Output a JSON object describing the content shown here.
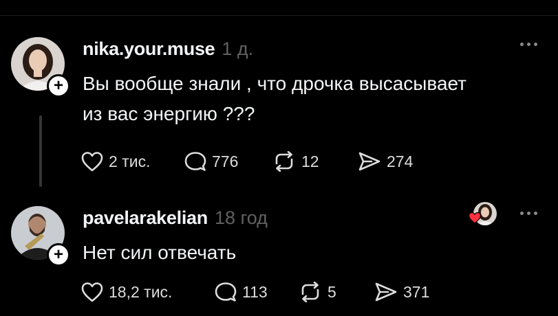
{
  "posts": [
    {
      "username": "nika.your.muse",
      "time": "1 д.",
      "text_lines": [
        "Вы вообще знали , что дрочка высасывает",
        "из вас энергию ???"
      ],
      "likes": "2 тис.",
      "comments": "776",
      "reposts": "12",
      "shares": "274"
    },
    {
      "username": "pavelarakelian",
      "time": "18 год",
      "text_lines": [
        "Нет сил отвечать"
      ],
      "likes": "18,2 тис.",
      "comments": "113",
      "reposts": "5",
      "shares": "371"
    }
  ],
  "icons": {
    "follow": "plus-icon",
    "more": "more-dots-icon",
    "like": "heart-icon",
    "comment": "comment-bubble-icon",
    "repost": "repost-icon",
    "share": "send-icon",
    "liked_by_author": "liked-by-author-icon"
  },
  "colors": {
    "background": "#000000",
    "text": "#f3f5f7",
    "muted": "#616161",
    "icon": "#dddddd",
    "heart_red": "#ff3040",
    "thread_line": "#333638"
  }
}
